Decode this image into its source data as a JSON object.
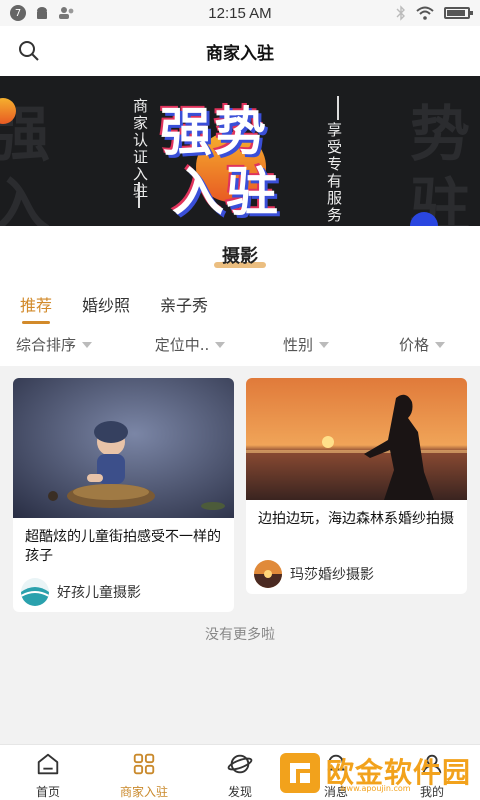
{
  "status_bar": {
    "time": "12:15 AM",
    "notification_count": "7"
  },
  "header": {
    "title": "商家入驻"
  },
  "banner": {
    "left_vertical": "商家认证入驻",
    "headline_1": "强势",
    "headline_2": "入驻",
    "right_vertical": "享受专有服务",
    "ghost_left": "强",
    "ghost_left_2": "入",
    "ghost_right": "势",
    "ghost_right_2": "驻"
  },
  "category": {
    "title": "摄影",
    "tabs": [
      {
        "label": "推荐",
        "active": true
      },
      {
        "label": "婚纱照",
        "active": false
      },
      {
        "label": "亲子秀",
        "active": false
      }
    ],
    "filters": [
      "综合排序",
      "定位中..",
      "性别",
      "价格"
    ]
  },
  "cards": [
    {
      "title": "超酷炫的儿童街拍感受不一样的孩子",
      "merchant": "好孩儿童摄影"
    },
    {
      "title": "边拍边玩，海边森林系婚纱拍摄",
      "merchant": "玛莎婚纱摄影"
    }
  ],
  "list_end_text": "没有更多啦",
  "tab_bar": [
    {
      "label": "首页",
      "icon": "home-icon",
      "active": false
    },
    {
      "label": "商家入驻",
      "icon": "grid-icon",
      "active": true
    },
    {
      "label": "发现",
      "icon": "planet-icon",
      "active": false
    },
    {
      "label": "消息",
      "icon": "bell-icon",
      "active": false
    },
    {
      "label": "我的",
      "icon": "user-icon",
      "active": false
    }
  ],
  "watermark": {
    "text": "欧金软件园",
    "sub": "www.apoujin.com"
  },
  "colors": {
    "accent": "#d28a2a",
    "banner_bg": "#1b1c1e",
    "watermark": "#f2a21c"
  }
}
